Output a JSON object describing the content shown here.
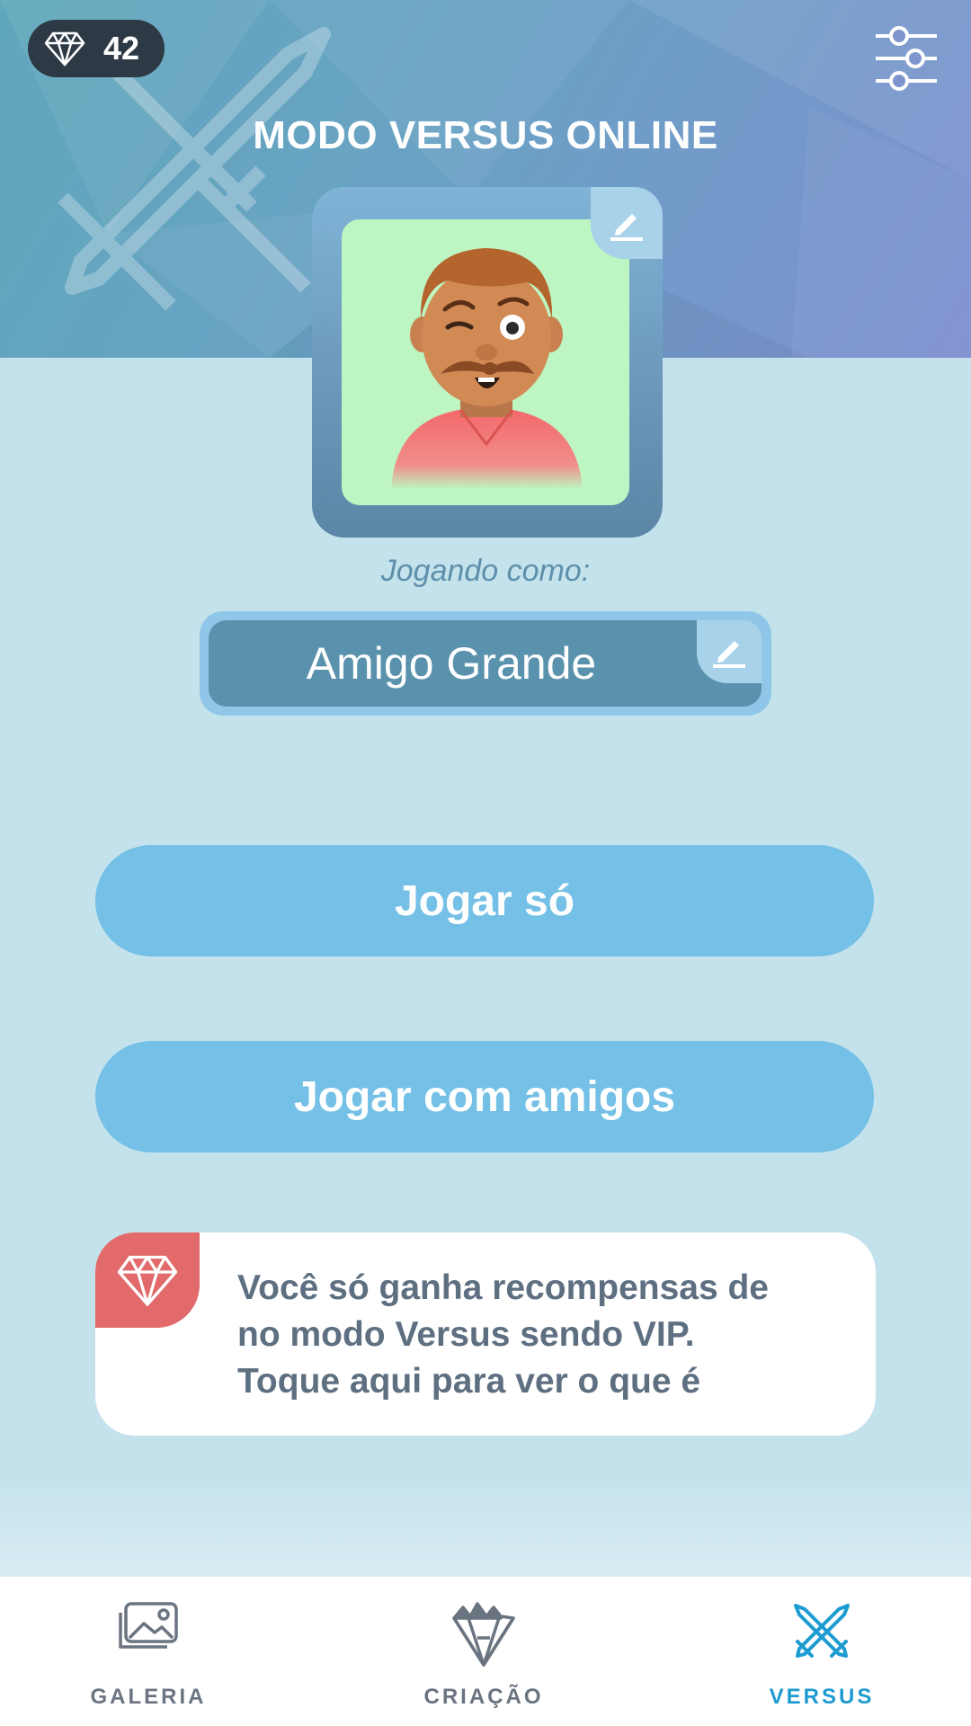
{
  "header": {
    "gems": "42",
    "title": "MODO VERSUS ONLINE"
  },
  "profile": {
    "playing_as_label": "Jogando como:",
    "player_name": "Amigo Grande"
  },
  "actions": {
    "play_solo": "Jogar só",
    "play_friends": "Jogar com amigos"
  },
  "vip_card": {
    "line1": "Você só ganha recompensas de",
    "line2": "no modo Versus sendo VIP.",
    "line3": "Toque aqui para ver o que é"
  },
  "tabs": [
    {
      "label": "GALERIA",
      "icon": "gallery-icon",
      "active": false
    },
    {
      "label": "CRIAÇÃO",
      "icon": "creation-icon",
      "active": false
    },
    {
      "label": "VERSUS",
      "icon": "swords-icon",
      "active": true
    }
  ],
  "colors": {
    "accent": "#74c0e6",
    "vip_badge": "#e26a6a",
    "active_tab": "#1e9bd0"
  }
}
